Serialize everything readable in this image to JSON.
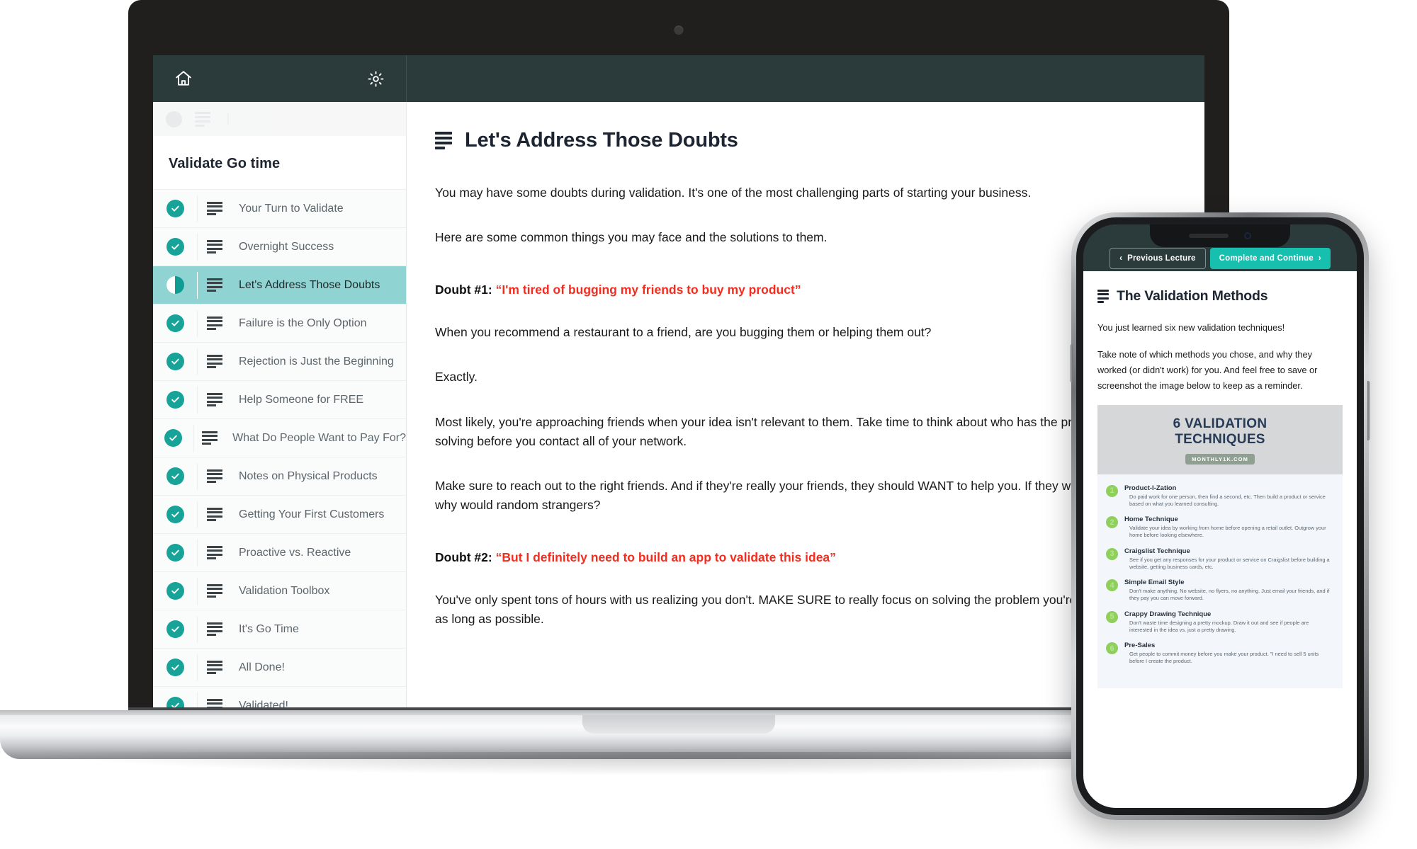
{
  "laptop": {
    "topbar": {
      "home_icon": "home-icon",
      "settings_icon": "gear-icon"
    },
    "sidebar": {
      "section_title": "Validate Go time",
      "items": [
        {
          "label": "Your Turn to Validate",
          "state": "complete"
        },
        {
          "label": "Overnight Success",
          "state": "complete"
        },
        {
          "label": "Let's Address Those Doubts",
          "state": "in-progress"
        },
        {
          "label": "Failure is the Only Option",
          "state": "complete"
        },
        {
          "label": "Rejection is Just the Beginning",
          "state": "complete"
        },
        {
          "label": "Help Someone for FREE",
          "state": "complete"
        },
        {
          "label": "What Do People Want to Pay For?",
          "state": "complete"
        },
        {
          "label": "Notes on Physical Products",
          "state": "complete"
        },
        {
          "label": "Getting Your First Customers",
          "state": "complete"
        },
        {
          "label": "Proactive vs. Reactive",
          "state": "complete"
        },
        {
          "label": "Validation Toolbox",
          "state": "complete"
        },
        {
          "label": "It's Go Time",
          "state": "complete"
        },
        {
          "label": "All Done!",
          "state": "complete"
        },
        {
          "label": "Validated!",
          "state": "complete"
        }
      ]
    },
    "content": {
      "title": "Let's Address Those Doubts",
      "p1": "You may have some doubts during validation. It's one of the most challenging parts of starting your business.",
      "p2": "Here are some common things you may face and the solutions to them.",
      "doubt1_label": "Doubt #1:",
      "doubt1_quote": "“I'm tired of bugging my friends to buy my product”",
      "p3": "When you recommend a restaurant to a friend, are you bugging them or helping them out?",
      "p4": "Exactly.",
      "p5": "Most likely, you're approaching friends when your idea isn't relevant to them. Take time to think about who has the problem you're solving before you contact all of your network.",
      "p6": "Make sure to reach out to the right friends. And if they're really your friends, they should WANT to help you. If they won't help you, why would random strangers?",
      "doubt2_label": "Doubt #2:",
      "doubt2_quote": "“But I definitely need to build an app to validate this idea”",
      "p7": "You've only spent tons of hours with us realizing you don't. MAKE SURE to really focus on solving the problem you're offering for as long as possible."
    }
  },
  "phone": {
    "nav": {
      "prev_label": "Previous Lecture",
      "next_label": "Complete and Continue",
      "prev_chevron": "‹",
      "next_chevron": "›"
    },
    "content": {
      "title": "The Validation Methods",
      "p1": "You just learned six new validation techniques!",
      "p2": "Take note of which methods you chose, and why they worked (or didn't work) for you. And feel free to save or screenshot the image below to keep as a reminder."
    },
    "infographic": {
      "title_line1": "6 VALIDATION",
      "title_line2": "TECHNIQUES",
      "badge": "MONTHLY1K.COM",
      "items": [
        {
          "num": "1",
          "name": "Product-I-Zation",
          "desc": "Do paid work for one person, then find a second, etc. Then build a product or service based on what you learned consulting."
        },
        {
          "num": "2",
          "name": "Home Technique",
          "desc": "Validate your idea by working from home before opening a retail outlet. Outgrow your home before looking elsewhere."
        },
        {
          "num": "3",
          "name": "Craigslist Technique",
          "desc": "See if you get any responses for your product or service on Craigslist before building a website, getting business cards, etc."
        },
        {
          "num": "4",
          "name": "Simple Email Style",
          "desc": "Don't make anything. No website, no flyers, no anything. Just email your friends, and if they pay you can move forward."
        },
        {
          "num": "5",
          "name": "Crappy Drawing Technique",
          "desc": "Don't waste time designing a pretty mockup. Draw it out and see if people are interested in the idea vs. just a pretty drawing."
        },
        {
          "num": "6",
          "name": "Pre-Sales",
          "desc": "Get people to commit money before you make your product. \"I need to sell 5 units before I create the product."
        }
      ]
    }
  },
  "colors": {
    "topbar": "#2b3b3b",
    "accent_teal": "#17a398",
    "active_row": "#8fd3d3",
    "quote_red": "#f42c1f",
    "button_green": "#17bfae",
    "info_green": "#8ed05a"
  }
}
